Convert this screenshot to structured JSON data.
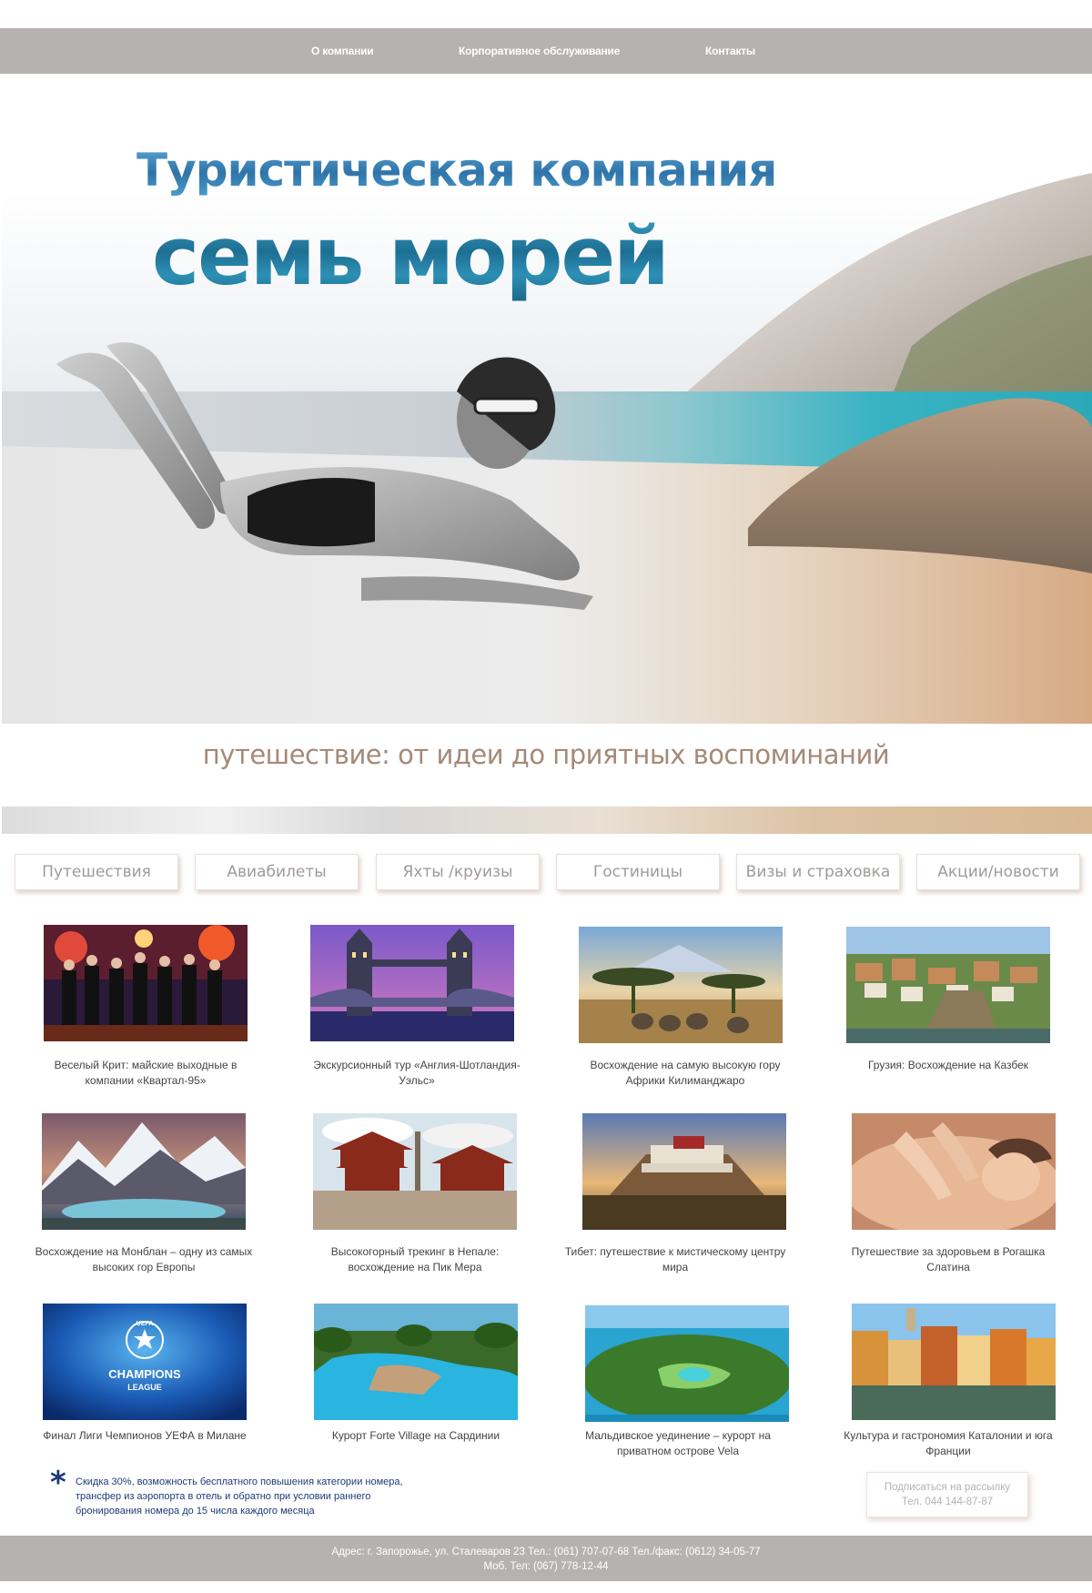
{
  "nav": {
    "items": [
      {
        "label": "О компании"
      },
      {
        "label": "Корпоративное обслуживание"
      },
      {
        "label": "Контакты"
      }
    ]
  },
  "hero": {
    "title_line1": "Туристическая компания",
    "title_line2": "семь морей"
  },
  "tagline": "путешествие: от идеи до приятных воспоминаний",
  "tabs": [
    {
      "label": "Путешествия"
    },
    {
      "label": "Авиабилеты"
    },
    {
      "label": "Яхты /круизы"
    },
    {
      "label": "Гостиницы"
    },
    {
      "label": "Визы  и страховка"
    },
    {
      "label": "Акции/новости"
    }
  ],
  "tours": [
    {
      "caption": "Веселый Крит: майские выходные в компании «Квартал-95»",
      "image": "stage-performers"
    },
    {
      "caption": "Экскурсионный тур «Англия-Шотландия-Уэльс»",
      "image": "tower-bridge-night"
    },
    {
      "caption": "Восхождение на самую высокую гору Африки Килиманджаро",
      "image": "savanna-elephants"
    },
    {
      "caption": "Грузия: Восхождение на Казбек",
      "image": "tbilisi-cityscape"
    },
    {
      "caption": "Восхождение на Монблан – одну из самых высоких гор Европы",
      "image": "alpine-lake"
    },
    {
      "caption": "Высокогорный трекинг в Непале: восхождение на Пик Мера",
      "image": "nepal-temples"
    },
    {
      "caption": "Тибет: путешествие к мистическому центру мира",
      "image": "potala-palace"
    },
    {
      "caption": "Путешествие за здоровьем в Рогашка Слатина",
      "image": "spa-massage"
    },
    {
      "caption": "Финал Лиги Чемпионов УЕФА в Милане",
      "image": "champions-league-logo"
    },
    {
      "caption": "Курорт Forte Village на Сардинии",
      "image": "resort-pool"
    },
    {
      "caption": "Мальдивское уединение – курорт на приватном острове Vela",
      "image": "island-golf"
    },
    {
      "caption": "Культура и гастрономия Каталонии и юга Франции",
      "image": "girona-riverside"
    }
  ],
  "logo_text": {
    "uefa": "UEFA",
    "champions": "CHAMPIONS",
    "league": "LEAGUE"
  },
  "note": {
    "symbol": "*",
    "text": "Скидка 30%, возможность бесплатного повышения категории номера, трансфер из аэропорта в отель и обратно при условии раннего бронирования номера до 15 числа каждого месяца"
  },
  "subscribe": {
    "label": "Подписаться на рассылку",
    "phone": "Тел. 044 144-87-87"
  },
  "footer": {
    "line1": "Адрес: г. Запорожье, ул. Сталеваров 23  Тел.: (061) 707-07-68  Тел./факс: (0612) 34-05-77",
    "line2": "Моб. Тел: (067) 778-12-44"
  },
  "colors": {
    "bar": "#b7b2b2",
    "title_blue": "#2f74a8",
    "tagline": "#a58a78",
    "note": "#1e3a78"
  }
}
